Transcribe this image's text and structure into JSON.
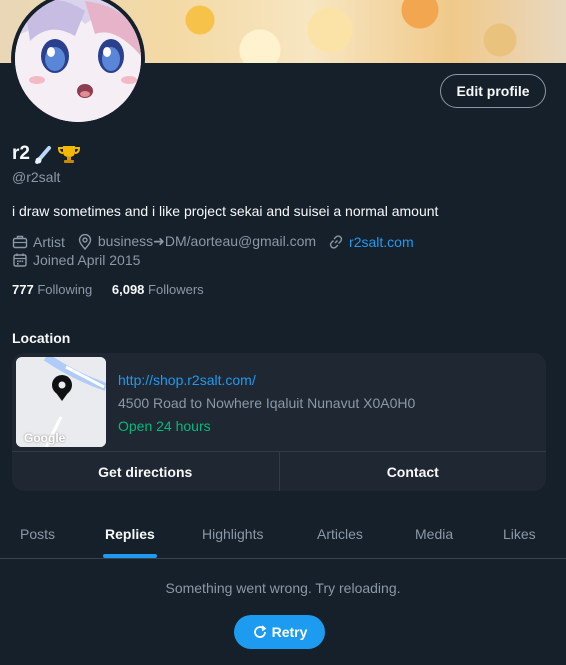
{
  "profile": {
    "name": "r2",
    "handle": "@r2salt",
    "bio": "i draw sometimes and i like project sekai and suisei a normal amount",
    "category": "Artist",
    "location_text": "business➜DM/aorteau@gmail.com",
    "website": "r2salt.com",
    "joined": "Joined April 2015",
    "following_count": "777",
    "following_label": "Following",
    "followers_count": "6,098",
    "followers_label": "Followers"
  },
  "buttons": {
    "edit_profile": "Edit profile"
  },
  "location_card": {
    "title": "Location",
    "url": "http://shop.r2salt.com/",
    "address": "4500 Road to Nowhere Iqaluit Nunavut X0A0H0",
    "hours": "Open 24 hours",
    "map_label": "Google",
    "directions": "Get directions",
    "contact": "Contact"
  },
  "tabs": [
    {
      "label": "Posts"
    },
    {
      "label": "Replies"
    },
    {
      "label": "Highlights"
    },
    {
      "label": "Articles"
    },
    {
      "label": "Media"
    },
    {
      "label": "Likes"
    }
  ],
  "active_tab": "Replies",
  "error": {
    "message": "Something went wrong. Try reloading.",
    "retry": "Retry"
  },
  "colors": {
    "background": "#15202b",
    "accent": "#1d9bf0",
    "muted": "#8b98a5",
    "success": "#00ba7c"
  }
}
